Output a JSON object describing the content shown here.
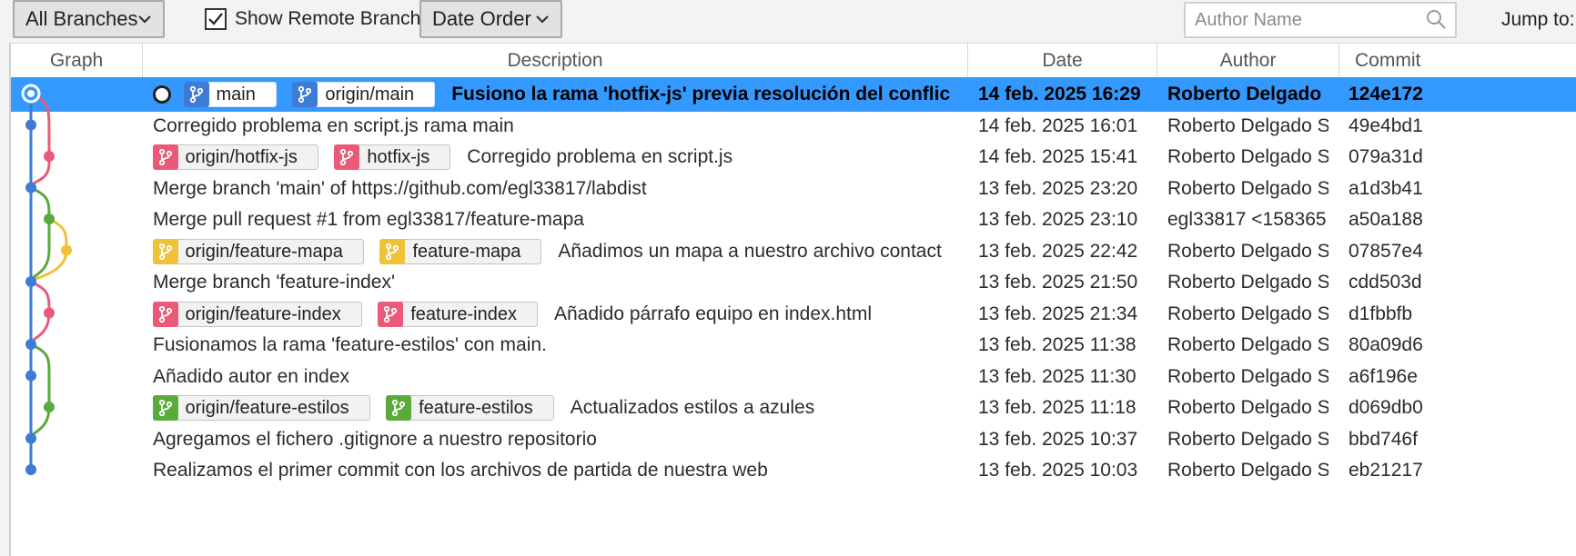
{
  "toolbar": {
    "branches_filter": "All Branches",
    "show_remote_label": "Show Remote Branches",
    "show_remote_checked": true,
    "order_filter": "Date Order",
    "author_placeholder": "Author Name",
    "jump_to_label": "Jump to:"
  },
  "columns": {
    "graph": "Graph",
    "description": "Description",
    "date": "Date",
    "author": "Author",
    "commit": "Commit"
  },
  "colors": {
    "selection": "#3399ff",
    "blue": "#3d7bd6",
    "red": "#ea5a78",
    "green": "#5aaa3c",
    "yellow": "#f0c23a"
  },
  "commits": [
    {
      "head": true,
      "branches": [
        {
          "name": "main",
          "color": "blue"
        },
        {
          "name": "origin/main",
          "color": "blue"
        }
      ],
      "message": "Fusiono la rama 'hotfix-js' previa resolución del conflic",
      "date": "14 feb. 2025 16:29",
      "author": "Roberto Delgado",
      "hash": "124e172",
      "selected": true
    },
    {
      "head": false,
      "branches": [],
      "message": "Corregido problema en script.js rama main",
      "date": "14 feb. 2025 16:01",
      "author": "Roberto Delgado S",
      "hash": "49e4bd1"
    },
    {
      "head": false,
      "branches": [
        {
          "name": "origin/hotfix-js",
          "color": "red"
        },
        {
          "name": "hotfix-js",
          "color": "red"
        }
      ],
      "message": "Corregido problema en script.js",
      "date": "14 feb. 2025 15:41",
      "author": "Roberto Delgado S",
      "hash": "079a31d"
    },
    {
      "head": false,
      "branches": [],
      "message": "Merge branch 'main' of https://github.com/egl33817/labdist",
      "date": "13 feb. 2025 23:20",
      "author": "Roberto Delgado S",
      "hash": "a1d3b41"
    },
    {
      "head": false,
      "branches": [],
      "message": "Merge pull request #1 from egl33817/feature-mapa",
      "date": "13 feb. 2025 23:10",
      "author": "egl33817 <158365",
      "hash": "a50a188"
    },
    {
      "head": false,
      "branches": [
        {
          "name": "origin/feature-mapa",
          "color": "yellow"
        },
        {
          "name": "feature-mapa",
          "color": "yellow"
        }
      ],
      "message": "Añadimos un mapa a nuestro archivo contact",
      "date": "13 feb. 2025 22:42",
      "author": "Roberto Delgado S",
      "hash": "07857e4"
    },
    {
      "head": false,
      "branches": [],
      "message": "Merge branch 'feature-index'",
      "date": "13 feb. 2025 21:50",
      "author": "Roberto Delgado S",
      "hash": "cdd503d"
    },
    {
      "head": false,
      "branches": [
        {
          "name": "origin/feature-index",
          "color": "red"
        },
        {
          "name": "feature-index",
          "color": "red"
        }
      ],
      "message": "Añadido párrafo equipo en index.html",
      "date": "13 feb. 2025 21:34",
      "author": "Roberto Delgado S",
      "hash": "d1fbbfb"
    },
    {
      "head": false,
      "branches": [],
      "message": "Fusionamos la rama 'feature-estilos' con main.",
      "date": "13 feb. 2025 11:38",
      "author": "Roberto Delgado S",
      "hash": "80a09d6"
    },
    {
      "head": false,
      "branches": [],
      "message": "Añadido autor en index",
      "date": "13 feb. 2025 11:30",
      "author": "Roberto Delgado S",
      "hash": "a6f196e"
    },
    {
      "head": false,
      "branches": [
        {
          "name": "origin/feature-estilos",
          "color": "green"
        },
        {
          "name": "feature-estilos",
          "color": "green"
        }
      ],
      "message": "Actualizados estilos a azules",
      "date": "13 feb. 2025 11:18",
      "author": "Roberto Delgado S",
      "hash": "d069db0"
    },
    {
      "head": false,
      "branches": [],
      "message": "Agregamos el fichero .gitignore a nuestro repositorio",
      "date": "13 feb. 2025 10:37",
      "author": "Roberto Delgado S",
      "hash": "bbd746f"
    },
    {
      "head": false,
      "branches": [],
      "message": "Realizamos el primer commit con los archivos de partida de nuestra web",
      "date": "13 feb. 2025 10:03",
      "author": "Roberto Delgado S",
      "hash": "eb21217"
    }
  ]
}
